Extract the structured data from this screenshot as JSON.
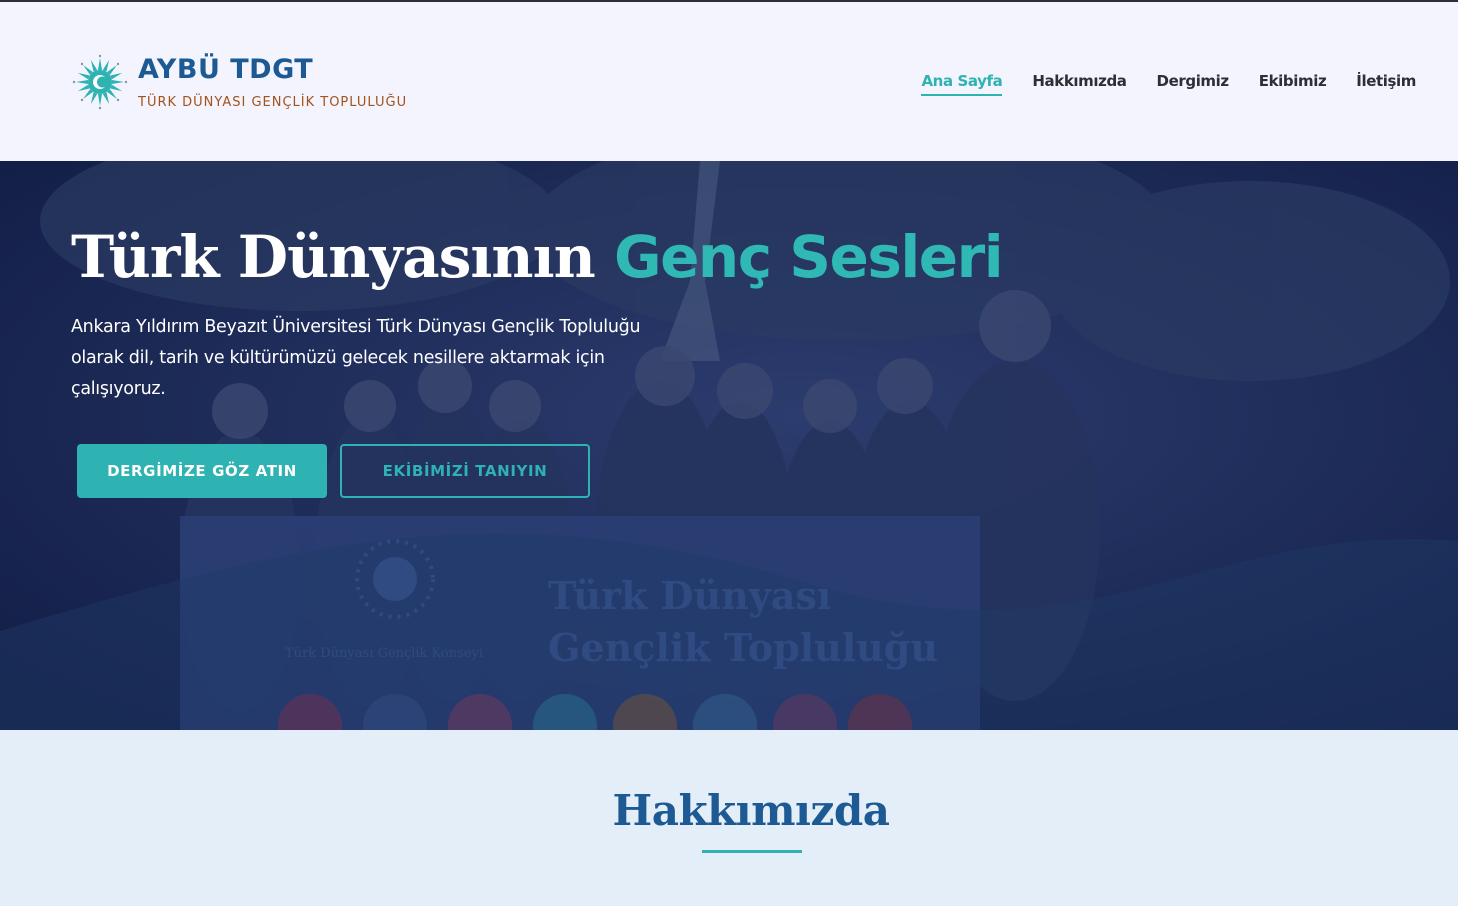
{
  "brand": {
    "title": "AYBÜ TDGT",
    "subtitle": "TÜRK DÜNYASI GENÇLİK TOPLULUĞU",
    "logo_icon": "sun-emblem-icon"
  },
  "nav": {
    "items": [
      {
        "label": "Ana Sayfa",
        "active": true
      },
      {
        "label": "Hakkımızda",
        "active": false
      },
      {
        "label": "Dergimiz",
        "active": false
      },
      {
        "label": "Ekibimiz",
        "active": false
      },
      {
        "label": "İletişim",
        "active": false
      }
    ]
  },
  "hero": {
    "title_main": "Türk Dünyasının",
    "title_accent": "Genç Sesleri",
    "description": "Ankara Yıldırım Beyazıt Üniversitesi Türk Dünyası Gençlik Topluluğu olarak dil, tarih ve kültürümüzü gelecek nesillere aktarmak için çalışıyoruz.",
    "primary_button": "DERGİMİZE GÖZ ATIN",
    "secondary_button": "EKİBİMİZİ TANIYIN",
    "banner_line1": "Türk Dünyası",
    "banner_line2": "Gençlik Topluluğu",
    "banner_small": "Türk Dünyası Gençlik Konseyi"
  },
  "about": {
    "heading": "Hakkımızda"
  },
  "colors": {
    "accent": "#2eb2b2",
    "brand_blue": "#1d5a93",
    "brand_orange": "#a3521c",
    "hero_overlay": "#1a2a58",
    "header_bg": "#f3f4fd",
    "about_bg": "#e3eef8"
  }
}
